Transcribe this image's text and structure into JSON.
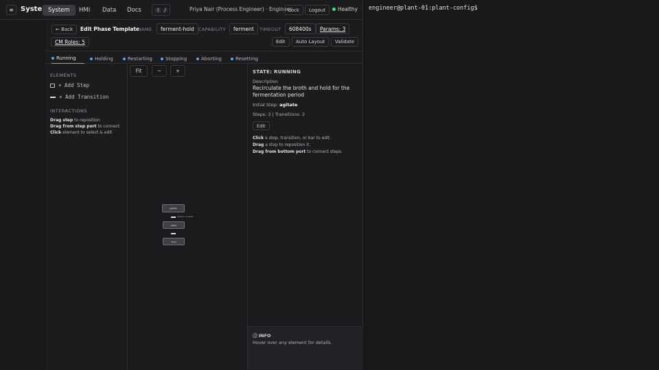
{
  "topbar": {
    "menu_icon": "≡",
    "brand": "System",
    "nav": [
      "System",
      "HMI",
      "Data",
      "Docs"
    ],
    "kbd_keys": [
      "⇧",
      "/"
    ],
    "user": "Priya Nair (Process Engineer) · Engineer",
    "lock": "Lock",
    "logout": "Logout",
    "health": "Healthy",
    "health_color": "#4ade80"
  },
  "terminal": {
    "prompt": "engineer@plant-01:plant-config$"
  },
  "editor": {
    "back": "← Back",
    "title": "Edit Phase Template",
    "name_label": "NAME",
    "name_value": "ferment-hold",
    "capability_label": "CAPABILITY",
    "capability_value": "ferment",
    "timeout_label": "TIMEOUT",
    "timeout_value": "608400s",
    "params": "Params: 3",
    "cm_roles": "CM Roles: 5",
    "edit": "Edit",
    "auto_layout": "Auto Layout",
    "validate": "Validate"
  },
  "tabs": [
    "Running",
    "Holding",
    "Restarting",
    "Stopping",
    "Aborting",
    "Resetting"
  ],
  "palette": {
    "elements_heading": "ELEMENTS",
    "add_step": "+ Add Step",
    "add_transition": "+ Add Transition",
    "interactions_heading": "INTERACTIONS",
    "hint1_bold": "Drag step",
    "hint1_rest": " to reposition",
    "hint2_bold": "Drag from step port",
    "hint2_rest": " to connect",
    "hint3_bold": "Click",
    "hint3_rest": " element to select & edit"
  },
  "canvas": {
    "fit": "Fit",
    "zoom_out": "−",
    "zoom_in": "+",
    "nodes": [
      "agitate",
      "settle",
      "drain"
    ],
    "transition_label": "agitation complete"
  },
  "props": {
    "state_title": "STATE: RUNNING",
    "description_label": "Description",
    "description": "Recirculate the broth and hold for the fermentation period",
    "initial_label": "Initial Step: ",
    "initial_value": "agitate",
    "counts": "Steps: 3 | Transitions: 2",
    "edit": "Edit",
    "help1_bold": "Click",
    "help1_rest": " a step, transition, or bar to edit.",
    "help2_bold": "Drag",
    "help2_rest": " a step to reposition it.",
    "help3_bold": "Drag from bottom port",
    "help3_rest": " to connect steps.",
    "info_title": "ⓘ INFO",
    "info_text": "Hover over any element for details."
  }
}
